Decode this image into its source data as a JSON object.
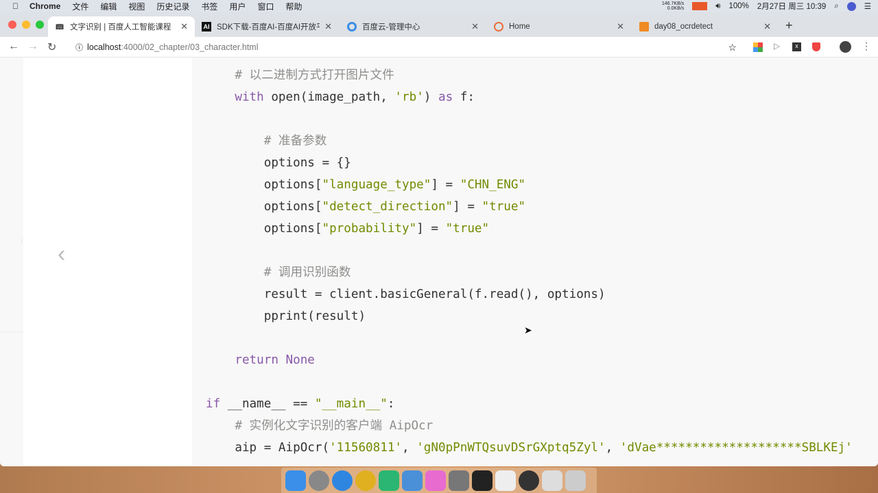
{
  "menubar": {
    "app": "Chrome",
    "items": [
      "文件",
      "编辑",
      "视图",
      "历史记录",
      "书签",
      "用户",
      "窗口",
      "帮助"
    ],
    "net_up": "146.7KB/s",
    "net_down": "0.0KB/s",
    "battery": "100%",
    "datetime": "2月27日 周三 10:39"
  },
  "tabs": [
    {
      "title": "文字识别 | 百度人工智能课程",
      "icon": "book-icon",
      "active": true
    },
    {
      "title": "SDK下载-百度AI-百度AI开放平",
      "icon": "ai-icon"
    },
    {
      "title": "百度云-管理中心",
      "icon": "baidu-cloud-icon"
    },
    {
      "title": "Home",
      "icon": "loading-icon"
    },
    {
      "title": "day08_ocrdetect",
      "icon": "notebook-icon"
    }
  ],
  "url": {
    "host": "localhost",
    "path": ":4000/02_chapter/03_character.html"
  },
  "code": [
    [
      {
        "t": "    "
      },
      {
        "t": "# 以二进制方式打开图片文件",
        "c": "cm"
      }
    ],
    [
      {
        "t": "    "
      },
      {
        "t": "with",
        "c": "kw"
      },
      {
        "t": " open(image_path, "
      },
      {
        "t": "'rb'",
        "c": "st"
      },
      {
        "t": ") "
      },
      {
        "t": "as",
        "c": "kw"
      },
      {
        "t": " f:"
      }
    ],
    [],
    [
      {
        "t": "        "
      },
      {
        "t": "# 准备参数",
        "c": "cm"
      }
    ],
    [
      {
        "t": "        options = {}"
      }
    ],
    [
      {
        "t": "        options["
      },
      {
        "t": "\"language_type\"",
        "c": "st"
      },
      {
        "t": "] = "
      },
      {
        "t": "\"CHN_ENG\"",
        "c": "st"
      }
    ],
    [
      {
        "t": "        options["
      },
      {
        "t": "\"detect_direction\"",
        "c": "st"
      },
      {
        "t": "] = "
      },
      {
        "t": "\"true\"",
        "c": "st"
      }
    ],
    [
      {
        "t": "        options["
      },
      {
        "t": "\"probability\"",
        "c": "st"
      },
      {
        "t": "] = "
      },
      {
        "t": "\"true\"",
        "c": "st"
      }
    ],
    [],
    [
      {
        "t": "        "
      },
      {
        "t": "# 调用识别函数",
        "c": "cm"
      }
    ],
    [
      {
        "t": "        result = client.basicGeneral(f.read(), options)"
      }
    ],
    [
      {
        "t": "        pprint(result)"
      }
    ],
    [],
    [
      {
        "t": "    "
      },
      {
        "t": "return None",
        "c": "kw"
      }
    ],
    [],
    [
      {
        "t": "if",
        "c": "kw"
      },
      {
        "t": " __name__ == "
      },
      {
        "t": "\"__main__\"",
        "c": "st"
      },
      {
        "t": ":"
      }
    ],
    [
      {
        "t": "    "
      },
      {
        "t": "# 实例化文字识别的客户端 AipOcr",
        "c": "cm"
      }
    ],
    [
      {
        "t": "    aip = AipOcr("
      },
      {
        "t": "'11560811'",
        "c": "st"
      },
      {
        "t": ", "
      },
      {
        "t": "'gN0pPnWTQsuvDSrGXptq5Zyl'",
        "c": "st"
      },
      {
        "t": ", "
      },
      {
        "t": "'dVae********************SBLKEj'",
        "c": "st"
      }
    ]
  ],
  "dock": [
    "finder",
    "launchpad",
    "safari",
    "chrome",
    "pycharm",
    "keynote",
    "xmind",
    "system-preferences",
    "terminal",
    "typora",
    "obs",
    "screenshot",
    "trash"
  ]
}
